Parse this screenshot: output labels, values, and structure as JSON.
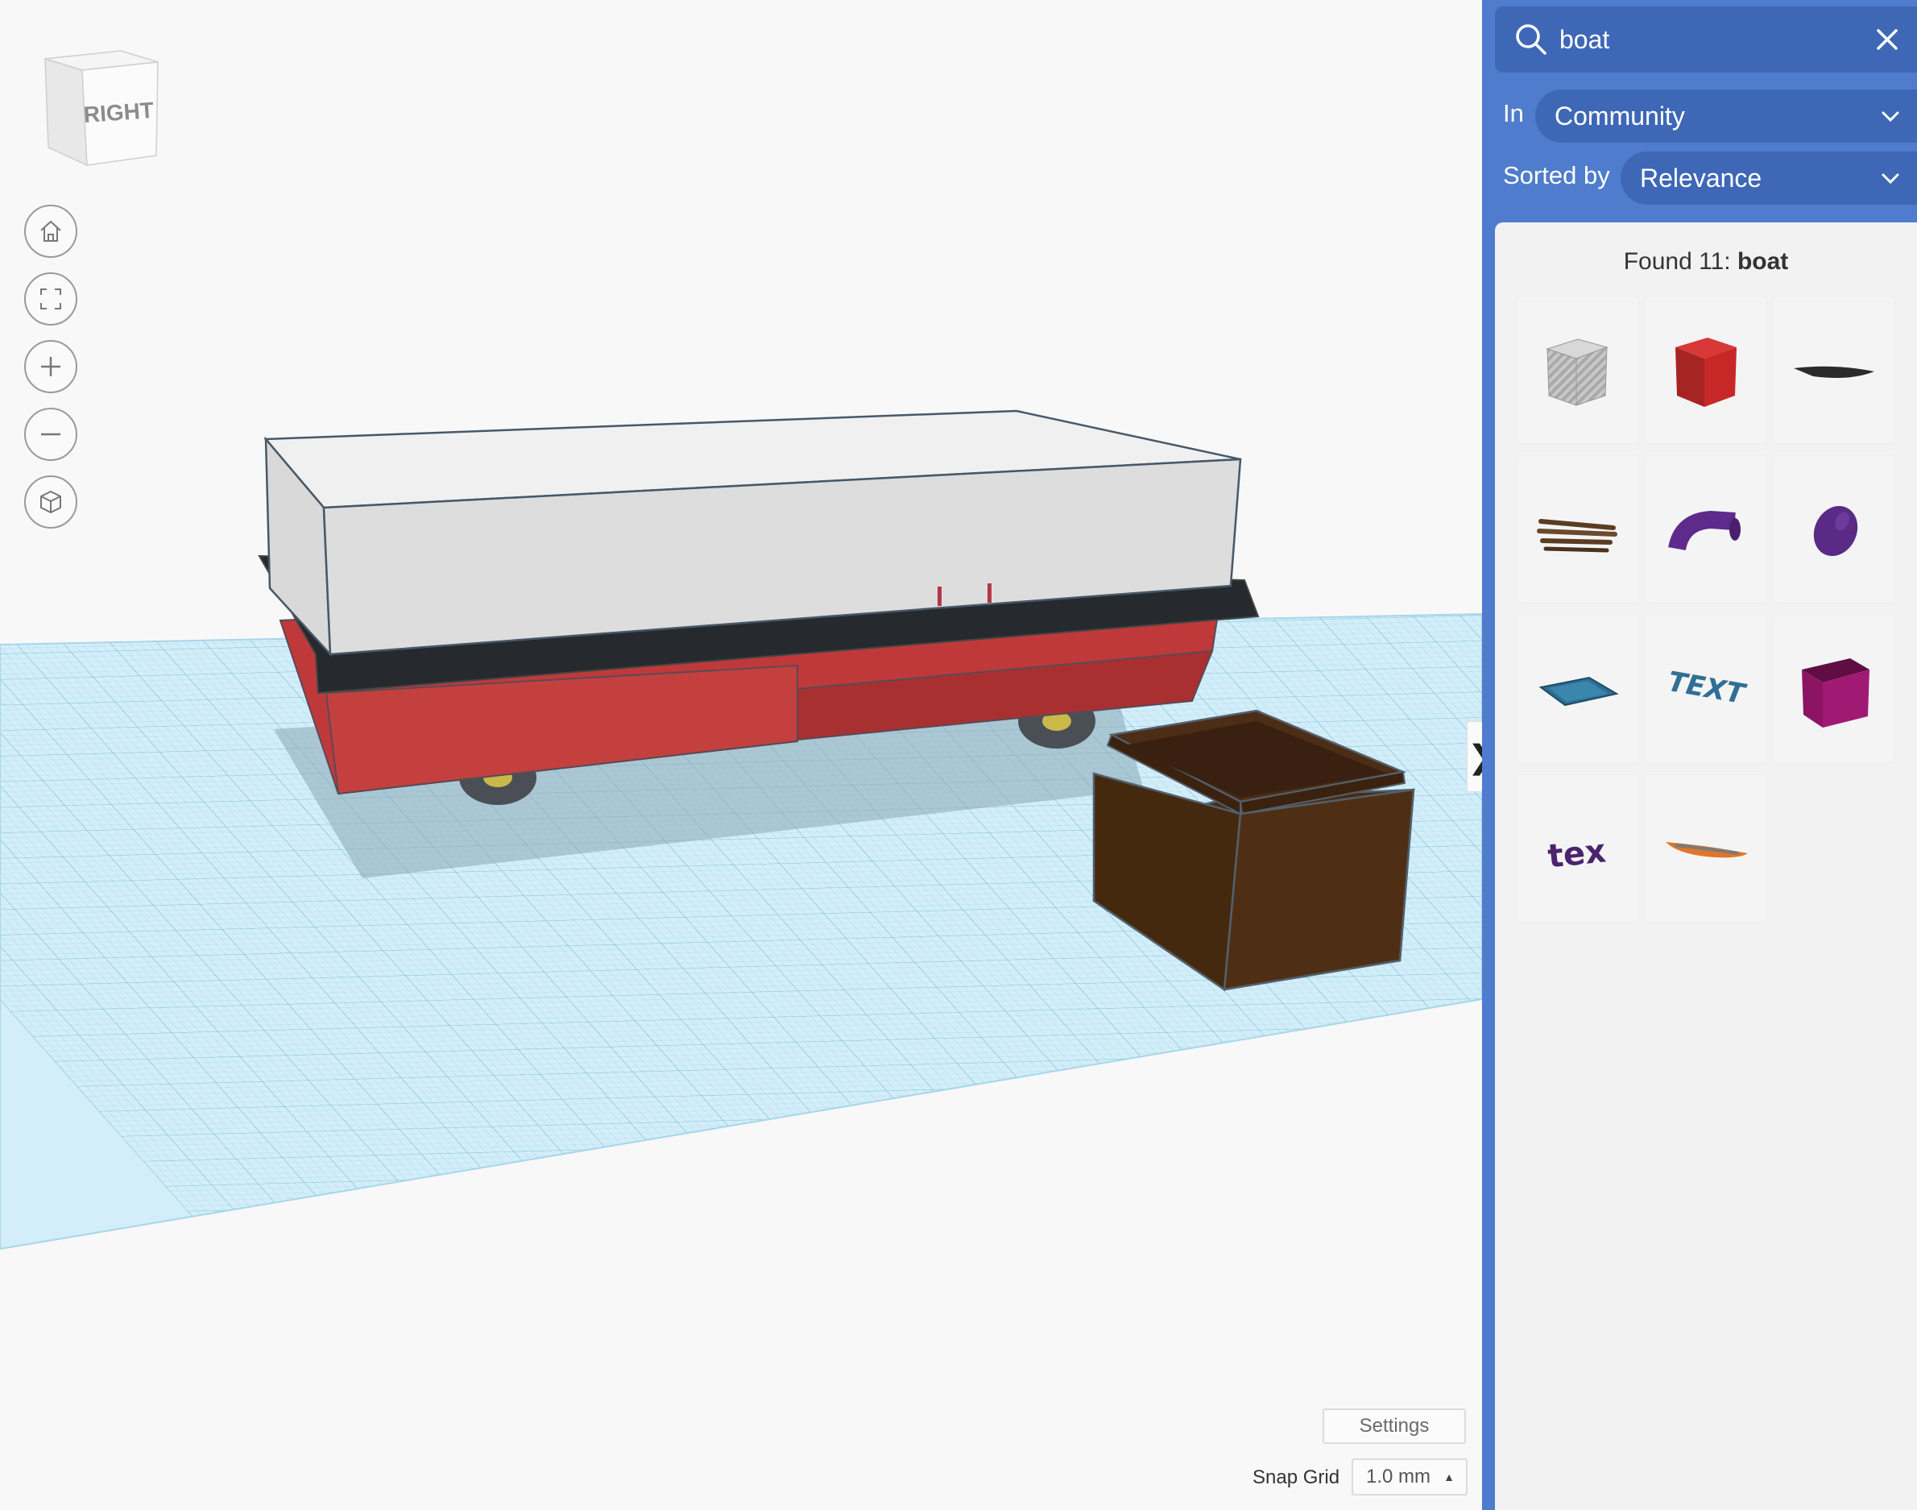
{
  "viewport": {
    "view_cube_label": "RIGHT",
    "nav_buttons": [
      {
        "name": "home-view-button",
        "icon": "home-icon"
      },
      {
        "name": "fit-view-button",
        "icon": "fit-frame-icon"
      },
      {
        "name": "zoom-in-button",
        "icon": "plus-icon"
      },
      {
        "name": "zoom-out-button",
        "icon": "minus-icon"
      },
      {
        "name": "projection-button",
        "icon": "cube-icon"
      }
    ],
    "settings_label": "Settings",
    "snap_grid_label": "Snap Grid",
    "snap_grid_value": "1.0 mm",
    "collapse_glyph": "❯"
  },
  "panel": {
    "search": {
      "value": "boat",
      "placeholder": ""
    },
    "in_label": "In",
    "in_value": "Community",
    "sort_label": "Sorted by",
    "sort_value": "Relevance",
    "found_prefix": "Found 11: ",
    "found_query": "boat",
    "results": [
      {
        "icon": "striped-cube-icon",
        "color": "#bdbdbd"
      },
      {
        "icon": "red-cube-icon",
        "color": "#c62828"
      },
      {
        "icon": "flat-boat-icon",
        "color": "#2b2b2b"
      },
      {
        "icon": "wood-planks-icon",
        "color": "#5a3d22"
      },
      {
        "icon": "curved-pipe-icon",
        "color": "#5e2a8c"
      },
      {
        "icon": "purple-egg-icon",
        "color": "#5a2a86"
      },
      {
        "icon": "blue-tray-icon",
        "color": "#2d6f93"
      },
      {
        "icon": "text-3d-icon",
        "color": "#2f6f96"
      },
      {
        "icon": "magenta-box-icon",
        "color": "#8b1563"
      },
      {
        "icon": "purple-text-icon",
        "color": "#4b246e"
      },
      {
        "icon": "orange-canoe-icon",
        "color": "#e0762b"
      }
    ]
  },
  "colors": {
    "panel_bg": "#4f7ccc",
    "panel_field": "#3e68b6",
    "grid_blue": "#bfe4f2",
    "hull_red": "#c0393a",
    "cabin_gray": "#dcdcdc",
    "box_brown": "#4a2c15"
  }
}
